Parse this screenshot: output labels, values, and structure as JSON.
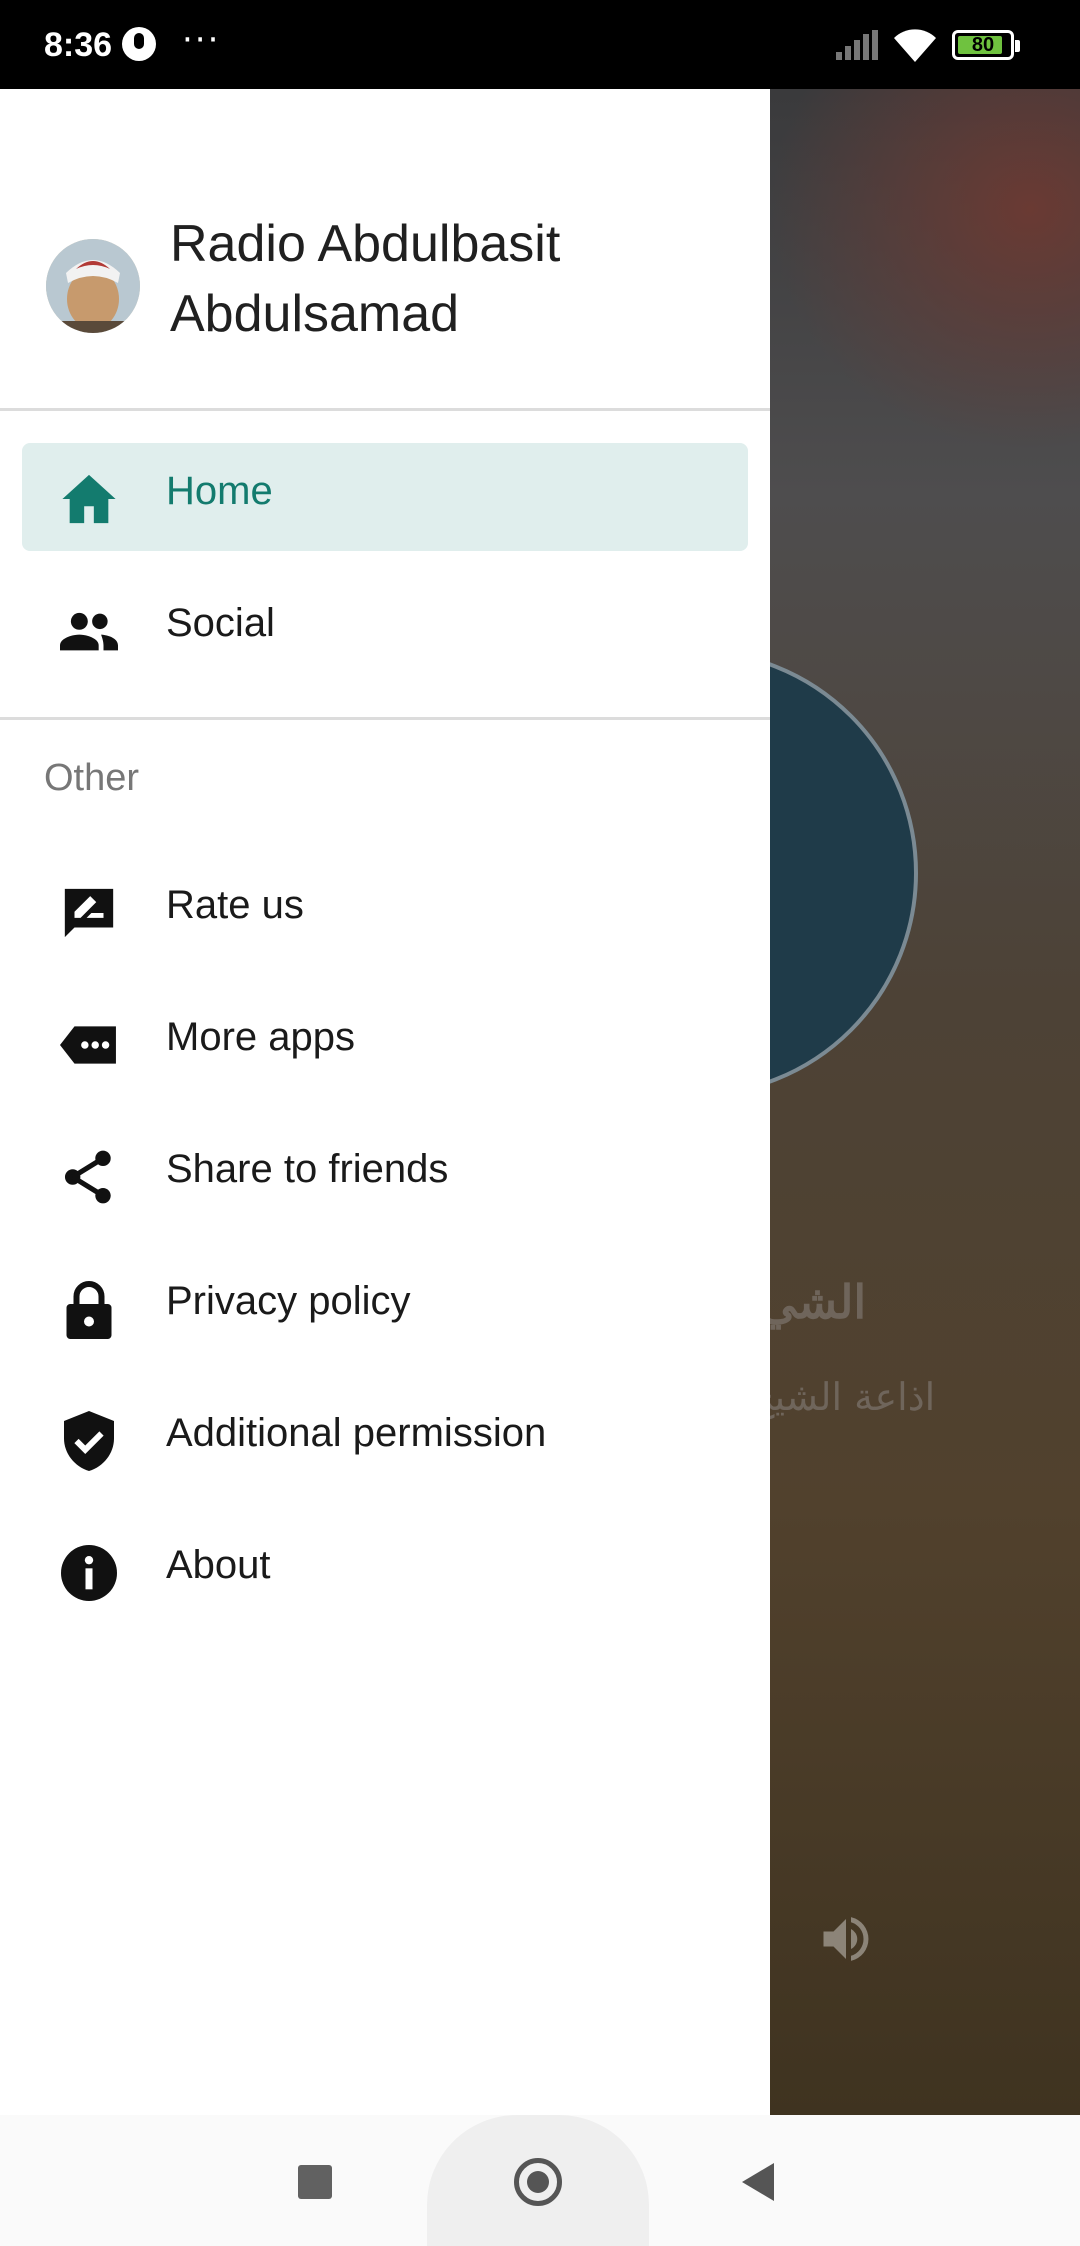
{
  "status_bar": {
    "time": "8:36",
    "dots": "···",
    "battery": "80"
  },
  "drawer": {
    "app_title": "Radio Abdulbasit Abdulsamad",
    "primary_items": [
      {
        "label": "Home",
        "icon": "home-icon",
        "selected": true
      },
      {
        "label": "Social",
        "icon": "people-icon"
      }
    ],
    "section_label": "Other",
    "other_items": [
      {
        "label": "Rate us",
        "icon": "rate-icon"
      },
      {
        "label": "More apps",
        "icon": "more-apps-icon"
      },
      {
        "label": "Share to friends",
        "icon": "share-icon"
      },
      {
        "label": "Privacy policy",
        "icon": "lock-icon"
      },
      {
        "label": "Additional permission",
        "icon": "shield-check-icon"
      },
      {
        "label": "About",
        "icon": "info-icon"
      }
    ]
  },
  "background": {
    "arabic_title": "الشي",
    "arabic_subtitle": "اذاعة الشيخ"
  },
  "colors": {
    "accent": "#137b6e",
    "selected_bg": "#e0eeed"
  }
}
